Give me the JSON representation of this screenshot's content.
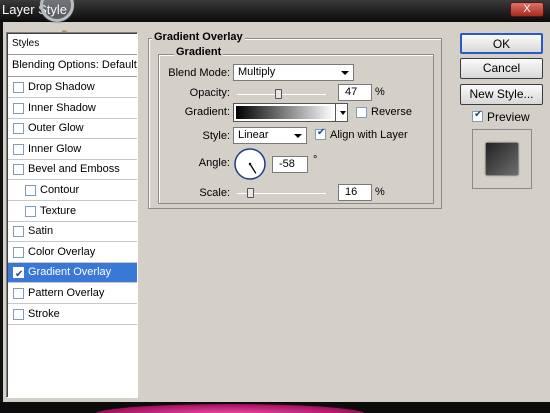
{
  "dialog": {
    "title": "Layer Style"
  },
  "window_controls": {
    "close_label": "X"
  },
  "sidebar": {
    "header": "Styles",
    "blending": "Blending Options: Default",
    "items": [
      {
        "label": "Drop Shadow",
        "checked": false
      },
      {
        "label": "Inner Shadow",
        "checked": false
      },
      {
        "label": "Outer Glow",
        "checked": false
      },
      {
        "label": "Inner Glow",
        "checked": false
      },
      {
        "label": "Bevel and Emboss",
        "checked": false
      },
      {
        "label": "Contour",
        "checked": false
      },
      {
        "label": "Texture",
        "checked": false
      },
      {
        "label": "Satin",
        "checked": false
      },
      {
        "label": "Color Overlay",
        "checked": false
      },
      {
        "label": "Gradient Overlay",
        "checked": true,
        "selected": true
      },
      {
        "label": "Pattern Overlay",
        "checked": false
      },
      {
        "label": "Stroke",
        "checked": false
      }
    ],
    "check_mark": "✔"
  },
  "panel": {
    "title": "Gradient Overlay",
    "group": "Gradient",
    "blend_mode_label": "Blend Mode:",
    "blend_mode_value": "Multiply",
    "opacity_label": "Opacity:",
    "opacity_value": "47",
    "opacity_unit": "%",
    "opacity_fraction": 0.47,
    "gradient_label": "Gradient:",
    "reverse_label": "Reverse",
    "reverse_checked": false,
    "style_label": "Style:",
    "style_value": "Linear",
    "align_label": "Align with Layer",
    "align_checked": true,
    "angle_label": "Angle:",
    "angle_value": "-58",
    "angle_unit": "°",
    "angle_degrees": -58,
    "scale_label": "Scale:",
    "scale_value": "16",
    "scale_unit": "%",
    "scale_fraction": 0.16
  },
  "buttons": {
    "ok": "OK",
    "cancel": "Cancel",
    "new_style": "New Style..."
  },
  "preview": {
    "label": "Preview",
    "checked": true
  },
  "colors": {
    "selection": "#3a78d8",
    "dialog_bg": "#d4d0c8"
  }
}
